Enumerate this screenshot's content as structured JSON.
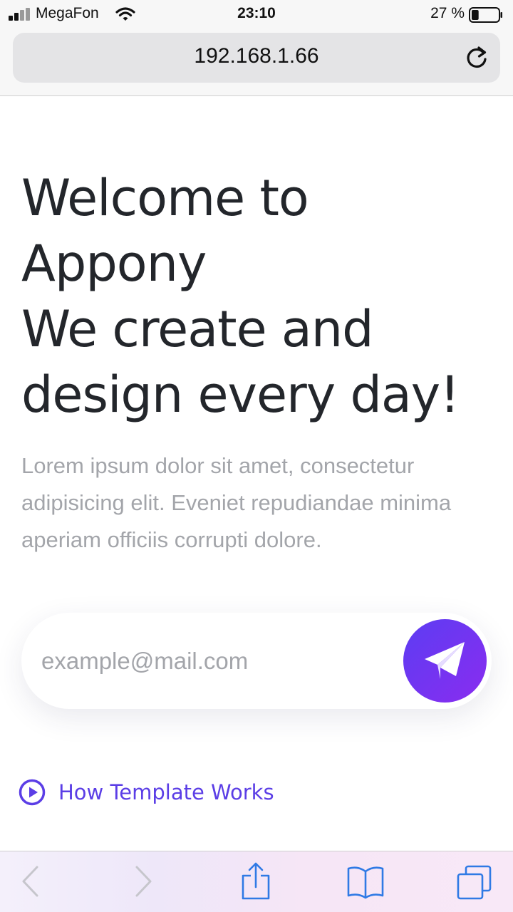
{
  "status_bar": {
    "carrier": "MegaFon",
    "time": "23:10",
    "battery_percent": "27 %",
    "battery_level": 0.27,
    "icons": [
      "signal-icon",
      "wifi-icon",
      "battery-icon"
    ]
  },
  "browser": {
    "url": "192.168.1.66",
    "reload_icon": "reload-icon"
  },
  "hero": {
    "title_lines": [
      "Welcome to",
      "Appony",
      "We create and",
      "design every day!"
    ],
    "description": "Lorem ipsum dolor sit amet, consectetur adipisicing elit. Eveniet repudiandae minima aperiam officiis corrupti dolore."
  },
  "email_form": {
    "placeholder": "example@mail.com",
    "send_icon": "paper-plane-icon"
  },
  "how_link": {
    "label": "How Template Works",
    "icon": "play-circle-icon"
  },
  "toolbar": {
    "icons": [
      "back-icon",
      "forward-icon",
      "share-icon",
      "bookmarks-icon",
      "tabs-icon"
    ]
  },
  "colors": {
    "accent": "#5b3ee6",
    "gradient_start": "#5c3df2",
    "gradient_end": "#8a2cf0",
    "heading": "#23262b",
    "muted_text": "#a3a5aa",
    "toolbar_icon": "#2f7ae5",
    "toolbar_icon_disabled": "#c6c6cc"
  }
}
